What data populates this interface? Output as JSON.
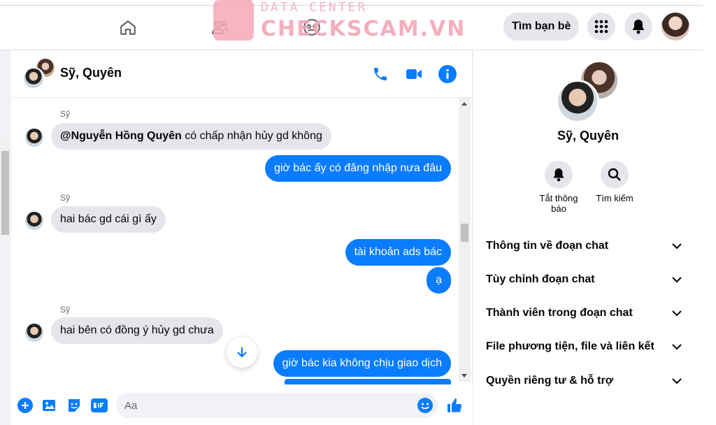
{
  "topbar": {
    "find_friends_label": "Tìm bạn bè"
  },
  "watermark": {
    "line1": "DATA CENTER",
    "line2": "CHECKSCAM.VN"
  },
  "chat": {
    "title": "Sỹ, Quyên",
    "messages": {
      "m1_sender": "Sỹ",
      "m1_mention": "@Nguyễn Hồng Quyên",
      "m1_text": " có chấp nhận hủy gd không",
      "m2_text": "giờ bác ấy có đăng nhập nưa đâu",
      "m3_sender": "Sỹ",
      "m3_text": "hai bác gd cái gì ấy",
      "m4_text": "tài khoản ads bác",
      "m5_text": "ạ",
      "m6_sender": "Sỹ",
      "m6_text": "hai bên có đồng ý hủy gd chưa",
      "m7_text": "giờ bác kia không chịu giao dịch"
    },
    "composer_placeholder": "Aa"
  },
  "info": {
    "title": "Sỹ, Quyên",
    "actions": [
      {
        "label": "Tắt thông báo",
        "icon": "bell-icon"
      },
      {
        "label": "Tìm kiếm",
        "icon": "search-icon"
      }
    ],
    "sections": [
      "Thông tin về đoạn chat",
      "Tùy chỉnh đoạn chat",
      "Thành viên trong đoạn chat",
      "File phương tiện, file và liên kết",
      "Quyền riêng tư & hỗ trợ"
    ]
  },
  "colors": {
    "messenger_blue": "#0a7cff",
    "bubble_gray": "#e4e6eb"
  }
}
